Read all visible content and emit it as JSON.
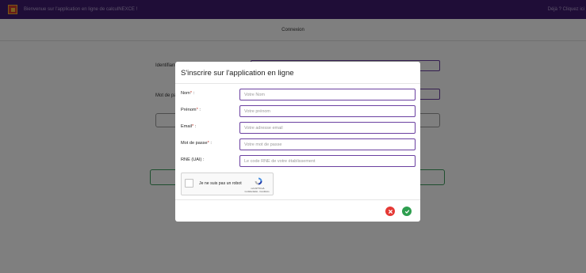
{
  "topbar": {
    "welcome": "Bienvenue sur l'application en ligne de calculNEXCE !",
    "right_text": "Déjà ? Cliquez ici"
  },
  "page": {
    "title": "Connexion",
    "identifier_label": "Identifiant",
    "password_label": "Mot de passe"
  },
  "modal": {
    "title": "S'inscrire sur l'application en ligne",
    "fields": [
      {
        "label": "Nom",
        "required": "*",
        "suffix": " :",
        "placeholder": "Votre Nom"
      },
      {
        "label": "Prénom",
        "required": "*",
        "suffix": " :",
        "placeholder": "Votre prénom"
      },
      {
        "label": "Email",
        "required": "*",
        "suffix": " :",
        "placeholder": "Votre adresse email"
      },
      {
        "label": "Mot de passe",
        "required": "*",
        "suffix": " :",
        "placeholder": "Votre mot de passe"
      },
      {
        "label": "RNE (UAI)",
        "required": "",
        "suffix": " :",
        "placeholder": "Le code RNE de votre établissement"
      }
    ],
    "captcha": {
      "text": "Je ne suis pas un robot",
      "brand": "reCAPTCHA",
      "links": "Confidentialité - Conditions",
      "icon": "recaptcha-icon"
    },
    "footer": {
      "cancel_icon": "close-circle-icon",
      "confirm_icon": "check-circle-icon",
      "cancel_color": "#e53935",
      "confirm_color": "#2e9e4f"
    }
  },
  "colors": {
    "topbar": "#3f1b6e",
    "input_border": "#6a3fa0",
    "required": "#c0392b"
  }
}
